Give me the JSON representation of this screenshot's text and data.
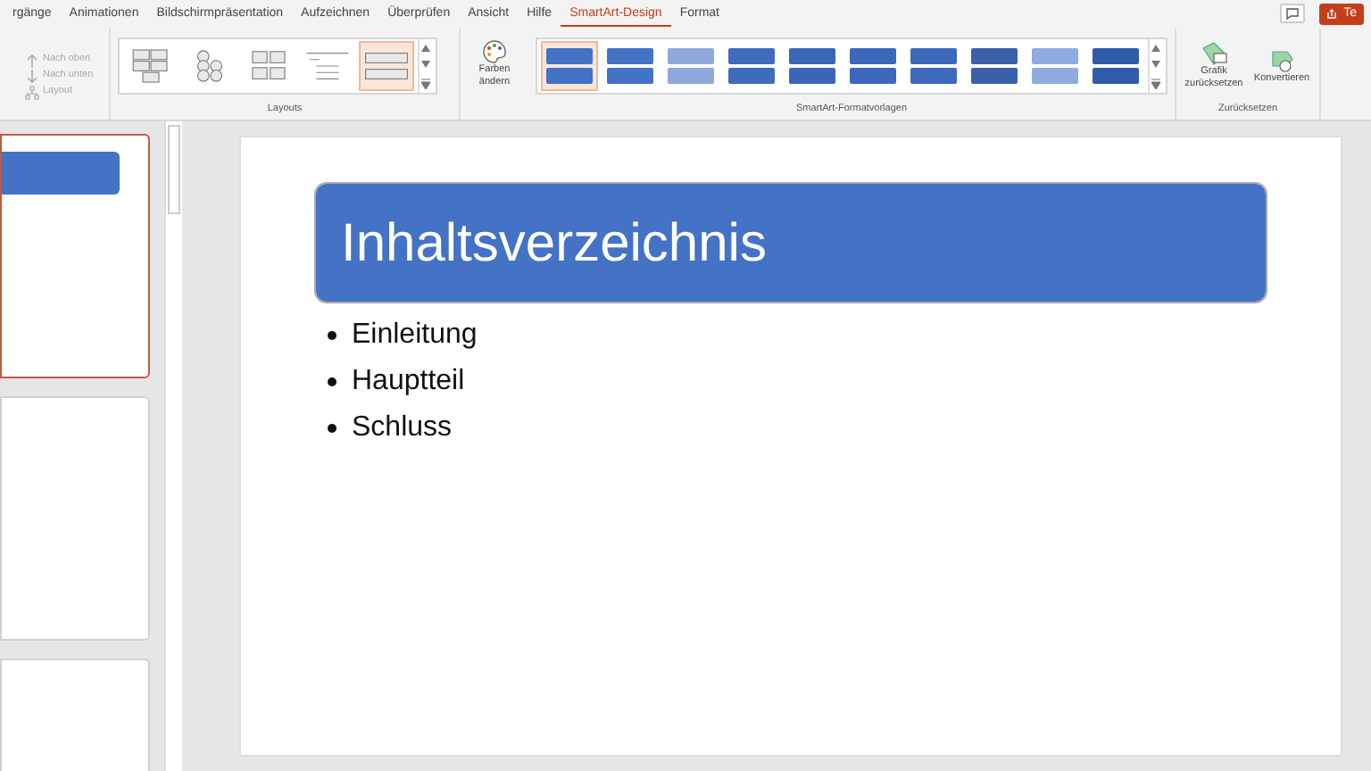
{
  "tabs": [
    {
      "label": "rgänge",
      "selected": false
    },
    {
      "label": "Animationen",
      "selected": false
    },
    {
      "label": "Bildschirmpräsentation",
      "selected": false
    },
    {
      "label": "Aufzeichnen",
      "selected": false
    },
    {
      "label": "Überprüfen",
      "selected": false
    },
    {
      "label": "Ansicht",
      "selected": false
    },
    {
      "label": "Hilfe",
      "selected": false
    },
    {
      "label": "SmartArt-Design",
      "selected": true
    },
    {
      "label": "Format",
      "selected": false
    }
  ],
  "share_button": {
    "label": "Te"
  },
  "arrange": [
    {
      "label": "Nach oben",
      "disabled": true,
      "kind": "up"
    },
    {
      "label": "Nach unten",
      "disabled": true,
      "kind": "down"
    },
    {
      "label": "Layout",
      "disabled": true,
      "kind": "layout"
    }
  ],
  "layouts": {
    "label": "Layouts",
    "items": [
      {
        "kind": "grid",
        "selected": false
      },
      {
        "kind": "circles",
        "selected": false
      },
      {
        "kind": "pairs",
        "selected": false
      },
      {
        "kind": "lines",
        "selected": false
      },
      {
        "kind": "bars",
        "selected": true
      }
    ]
  },
  "colors_button": {
    "label": "Farben ändern"
  },
  "styles": {
    "label": "SmartArt-Formatvorlagen",
    "items": [
      {
        "color": "#4472c4",
        "selected": true
      },
      {
        "color": "#4472c4",
        "selected": false
      },
      {
        "color": "#8fa9dc",
        "selected": false
      },
      {
        "color": "#3f6bbd",
        "selected": false
      },
      {
        "color": "#3b66b8",
        "selected": false
      },
      {
        "color": "#3c68bb",
        "selected": false
      },
      {
        "color": "#3d69bc",
        "selected": false
      },
      {
        "color": "#3a60a8",
        "selected": false
      },
      {
        "color": "#8fabe0",
        "selected": false
      },
      {
        "color": "#2f5ba8",
        "selected": false
      }
    ]
  },
  "reset_group": {
    "label": "Zurücksetzen",
    "buttons": [
      {
        "label": "Grafik zurücksetzen"
      },
      {
        "label": "Konvertieren"
      }
    ]
  },
  "thumbnails": [
    {
      "selected": true,
      "has_title": true
    },
    {
      "selected": false,
      "has_title": false
    },
    {
      "selected": false,
      "has_title": false
    }
  ],
  "slide": {
    "title": "Inhaltsverzeichnis",
    "bullets": [
      "Einleitung",
      "Hauptteil",
      "Schluss"
    ]
  }
}
